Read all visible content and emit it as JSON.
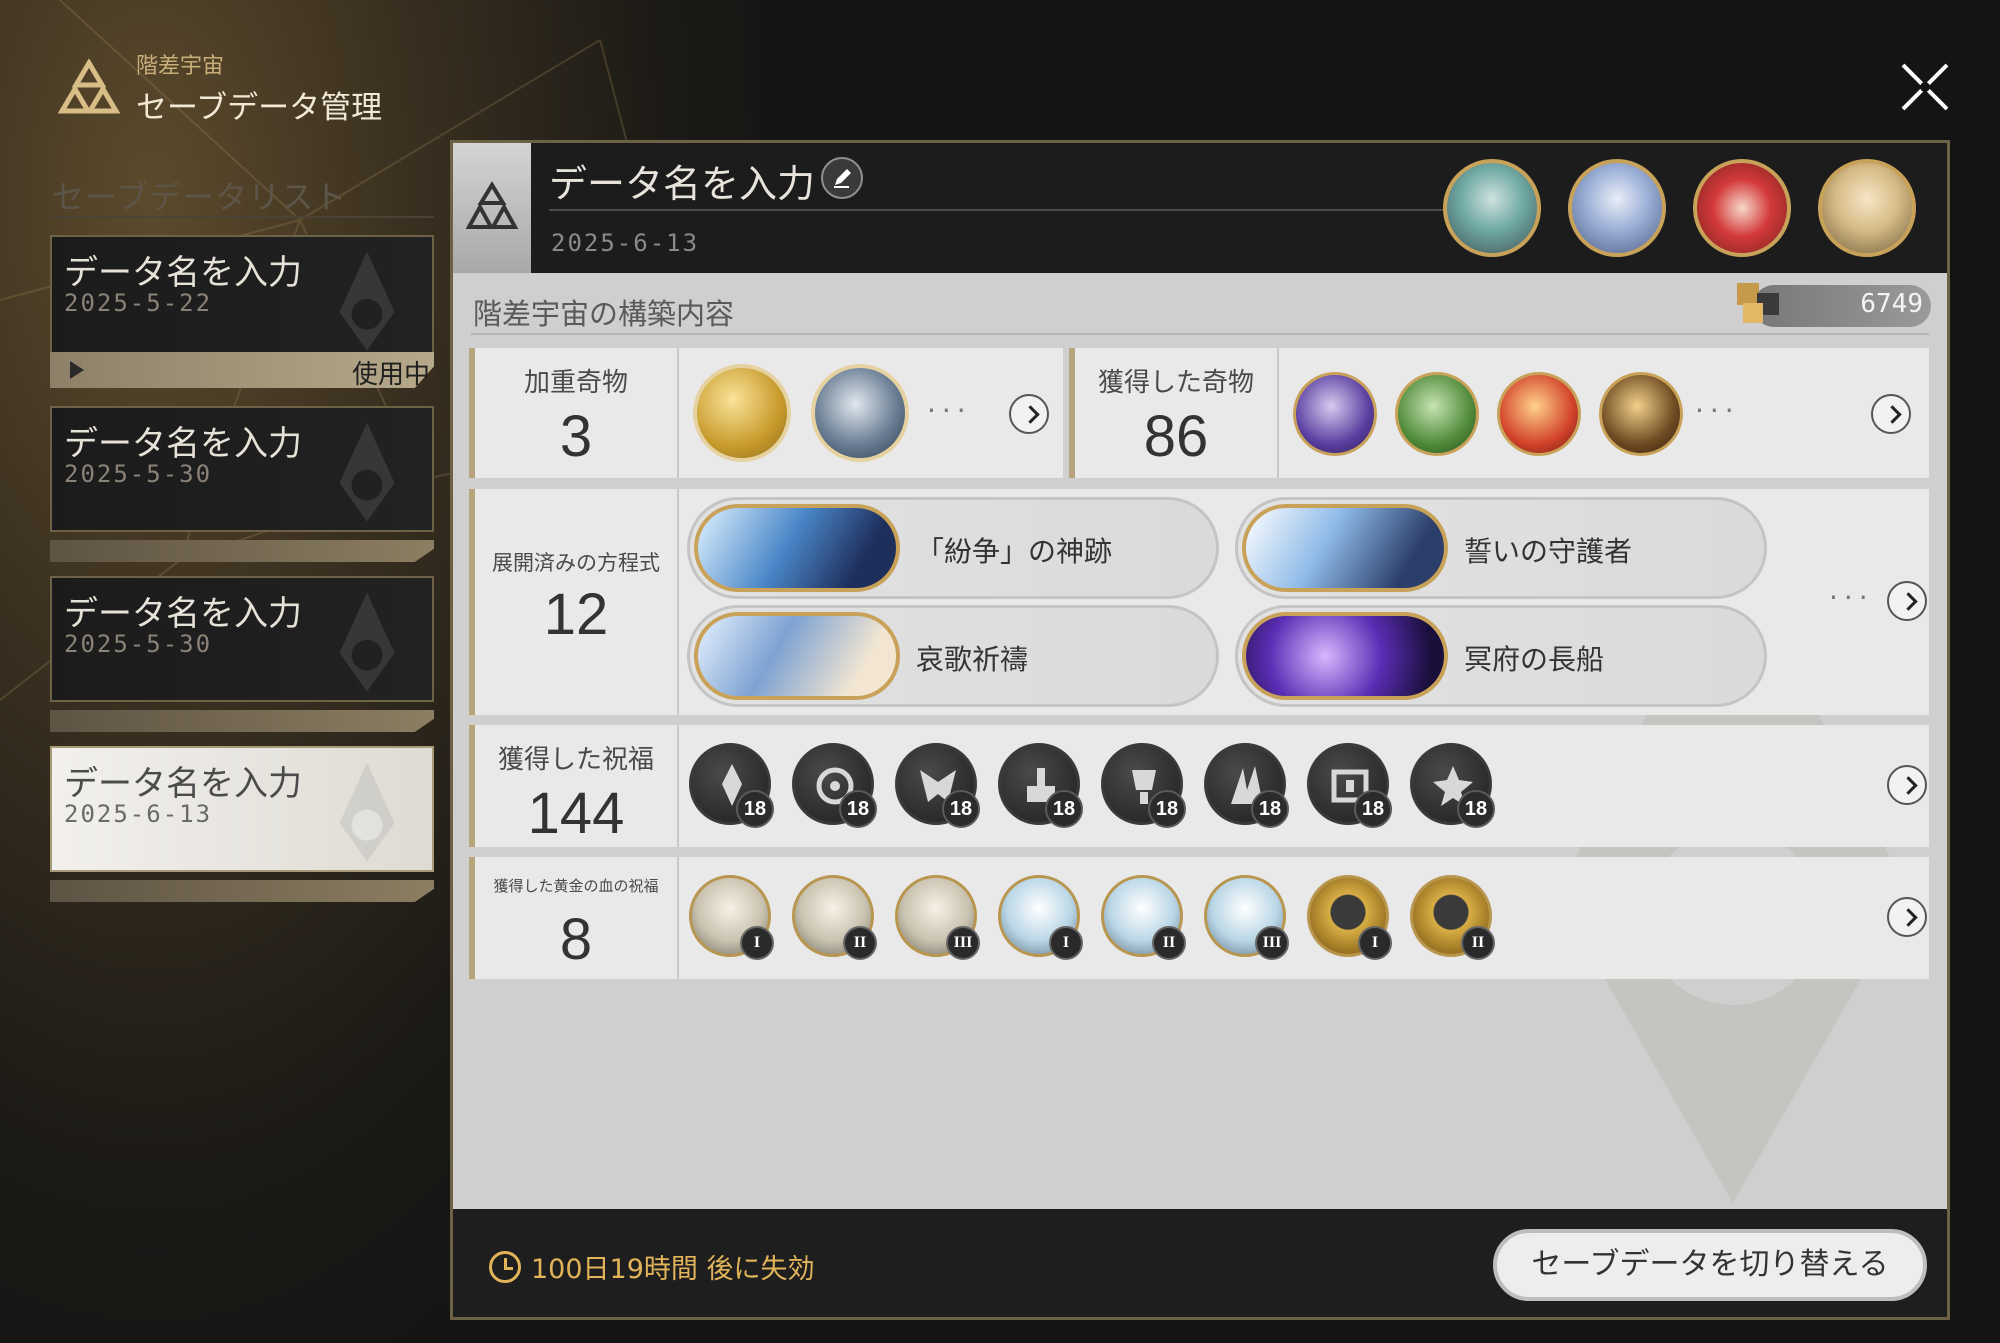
{
  "header": {
    "subtitle": "階差宇宙",
    "title": "セーブデータ管理"
  },
  "save_list": {
    "label": "セーブデータリスト",
    "in_use_label": "使用中",
    "slots": [
      {
        "name": "データ名を入力",
        "date": "2025-5-22"
      },
      {
        "name": "データ名を入力",
        "date": "2025-5-30"
      },
      {
        "name": "データ名を入力",
        "date": "2025-5-30"
      },
      {
        "name": "データ名を入力",
        "date": "2025-6-13"
      }
    ]
  },
  "panel": {
    "name": "データ名を入力",
    "date": "2025-6-13",
    "section_title": "階差宇宙の構築内容",
    "currency": "6749",
    "weighted_curios": {
      "label": "加重奇物",
      "count": "3"
    },
    "obtained_curios": {
      "label": "獲得した奇物",
      "count": "86"
    },
    "equations": {
      "label": "展開済みの方程式",
      "count": "12",
      "items": [
        "「紛争」の神跡",
        "誓いの守護者",
        "哀歌祈禱",
        "冥府の長船"
      ]
    },
    "blessings": {
      "label": "獲得した祝福",
      "count": "144",
      "levels": [
        "18",
        "18",
        "18",
        "18",
        "18",
        "18",
        "18",
        "18"
      ]
    },
    "golden_blessings": {
      "label": "獲得した黄金の血の祝福",
      "count": "8",
      "ranks": [
        "I",
        "II",
        "III",
        "I",
        "II",
        "III",
        "I",
        "II"
      ]
    },
    "expire_text": "100日19時間 後に失効",
    "switch_button": "セーブデータを切り替える"
  },
  "colors": {
    "accent_gold": "#c9a25a",
    "timer": "#e2b45a",
    "panel_bg": "#cfcfcf"
  },
  "icons": [
    "close-icon",
    "edit-icon",
    "clock-icon",
    "chevron-right-icon",
    "universe-emblem-icon"
  ]
}
